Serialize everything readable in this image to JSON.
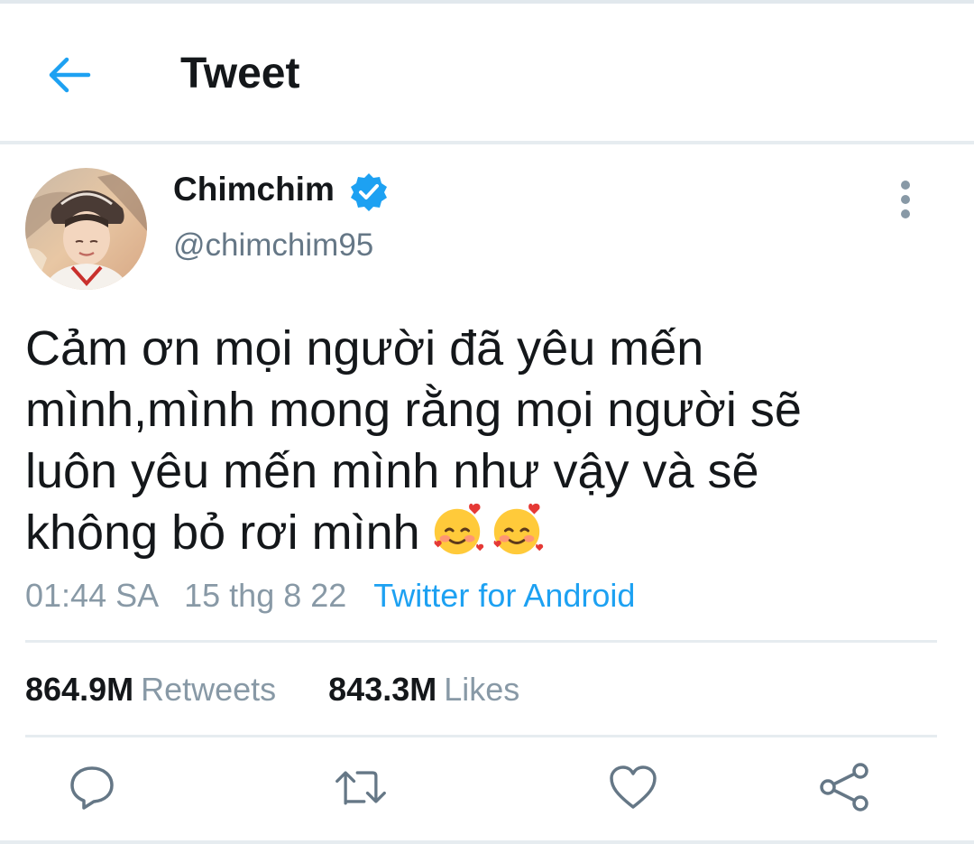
{
  "header": {
    "title": "Tweet",
    "back_icon": "arrow-left-icon"
  },
  "author": {
    "display_name": "Chimchim",
    "handle": "@chimchim95",
    "verified": true,
    "verified_icon": "verified-badge-icon"
  },
  "tweet": {
    "text": "Cảm ơn mọi người đã yêu mến\nmình,mình mong rằng mọi người sẽ\nluôn yêu mến mình như vậy và sẽ\nkhông bỏ rơi mình",
    "emojis": [
      "smiling-face-with-hearts",
      "smiling-face-with-hearts"
    ],
    "time": "01:44 SA",
    "date": "15 thg 8 22",
    "source": "Twitter for Android"
  },
  "stats": {
    "retweets_count": "864.9M",
    "retweets_label": "Retweets",
    "likes_count": "843.3M",
    "likes_label": "Likes"
  },
  "actions": [
    "reply-icon",
    "retweet-icon",
    "like-icon",
    "share-icon"
  ],
  "colors": {
    "accent": "#1da1f2",
    "text_primary": "#14171a",
    "text_secondary": "#657786",
    "divider": "#e6ecf0"
  }
}
